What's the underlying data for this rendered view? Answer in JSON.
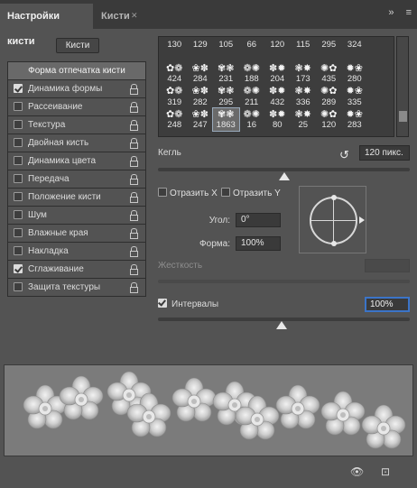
{
  "tabs": {
    "active": "Настройки кисти",
    "inactive": "Кисти",
    "collapse_icon": "double-chevron-icon",
    "menu_icon": "hamburger-menu-icon"
  },
  "brushes_button": "Кисти",
  "left_panel": {
    "tip_shape": "Форма отпечатка кисти",
    "options": [
      {
        "label": "Динамика формы",
        "checked": true
      },
      {
        "label": "Рассеивание",
        "checked": false
      },
      {
        "label": "Текстура",
        "checked": false
      },
      {
        "label": "Двойная кисть",
        "checked": false
      },
      {
        "label": "Динамика цвета",
        "checked": false
      },
      {
        "label": "Передача",
        "checked": false
      },
      {
        "label": "Положение кисти",
        "checked": false
      },
      {
        "label": "Шум",
        "checked": false
      },
      {
        "label": "Влажные края",
        "checked": false
      },
      {
        "label": "Накладка",
        "checked": false
      },
      {
        "label": "Сглаживание",
        "checked": true
      },
      {
        "label": "Защита текстуры",
        "checked": false
      }
    ]
  },
  "brush_grid": {
    "top_row": [
      "130",
      "129",
      "105",
      "66",
      "120",
      "115",
      "295",
      "324"
    ],
    "row2": [
      "424",
      "284",
      "231",
      "188",
      "204",
      "173",
      "435",
      "280"
    ],
    "row3": [
      "319",
      "282",
      "295",
      "211",
      "432",
      "336",
      "289",
      "335"
    ],
    "row4": [
      "248",
      "247",
      "1863",
      "16",
      "80",
      "25",
      "120",
      "283"
    ],
    "selected": "1863"
  },
  "size": {
    "label": "Кегль",
    "value": "120 пикс.",
    "reset_icon": "reset-arrow-icon",
    "slider_fraction": 0.5
  },
  "flip": {
    "x_label": "Отразить X",
    "y_label": "Отразить Y",
    "x_checked": false,
    "y_checked": false
  },
  "angle": {
    "label": "Угол:",
    "value": "0°"
  },
  "roundness": {
    "label": "Форма:",
    "value": "100%"
  },
  "hardness": {
    "label": "Жесткость",
    "value": ""
  },
  "spacing": {
    "label": "Интервалы",
    "checked": true,
    "value": "100%",
    "slider_fraction": 0.49
  },
  "bottom": {
    "eye_icon": "visibility-toggle-icon",
    "new_icon": "new-preset-icon"
  }
}
